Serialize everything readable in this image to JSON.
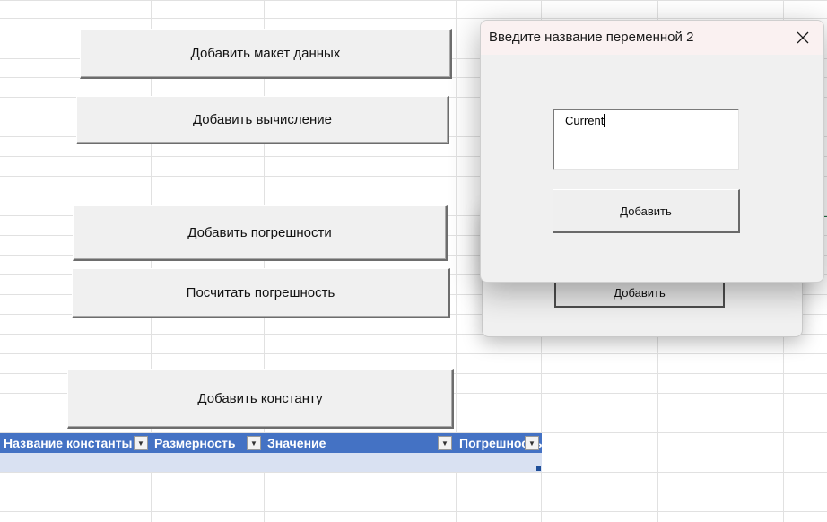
{
  "sheet": {
    "buttons": {
      "add_data_layout": "Добавить макет данных",
      "add_calculation": "Добавить вычисление",
      "add_errors": "Добавить погрешности",
      "calculate_error": "Посчитать погрешность",
      "add_constant": "Добавить константу"
    },
    "table": {
      "columns": [
        "Название константы",
        "Размерность",
        "Значение",
        "Погрешность"
      ]
    }
  },
  "back_dialog": {
    "add_label": "Добавить"
  },
  "dialog": {
    "title": "Введите название переменной 2",
    "input_value": "Current",
    "add_label": "Добавить",
    "close_icon": "close-icon"
  }
}
